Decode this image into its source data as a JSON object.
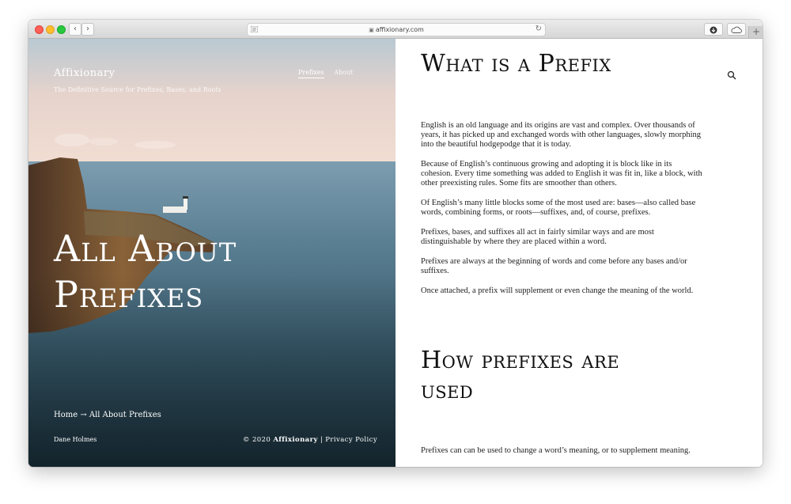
{
  "browser": {
    "url": "affixionary.com",
    "reload_glyph": "↻",
    "back_glyph": "‹",
    "forward_glyph": "›",
    "newtab_glyph": "+",
    "lock_glyph": "🔒"
  },
  "site": {
    "logo": "Affixionary",
    "tagline": "The Definitive Source for Prefixes, Bases, and Roots",
    "nav": [
      "Prefixes",
      "About"
    ]
  },
  "hero": {
    "title": "All About Prefixes",
    "breadcrumb": "Home → All About Prefixes",
    "author": "Dane Holmes",
    "copyright_prefix": "© 2020",
    "copyright_brand": "Affixionary",
    "copyright_sep": "|",
    "privacy_link": "Privacy Policy"
  },
  "article": {
    "heading1": "What is a Prefix",
    "paragraphs": [
      "English is an old language and its origins are vast and complex. Over thousands of years, it has picked up and exchanged words with other languages, slowly morphing into the beautiful hodgepodge that it is today.",
      "Because of English’s continuous growing and adopting it is block like in its cohesion. Every time something was added to English it was fit in, like a block, with other preexisting rules. Some fits are smoother than others.",
      "Of English’s many little blocks some of the most used are: bases—also called base words, combining forms, or roots—suffixes, and, of course, prefixes.",
      "Prefixes, bases, and suffixes all act in fairly similar ways and are most distinguishable by where they are placed within a word.",
      "Prefixes are always at the beginning of words and come before any bases and/or suffixes.",
      "Once attached, a prefix will supplement or even change the meaning of the world."
    ],
    "heading2": "How prefixes are used",
    "paragraph2": "Prefixes can can be used to change a word’s meaning, or to supplement meaning."
  },
  "colors": {
    "sky": "#e9d6cf",
    "sea": "#3e6475",
    "cliff": "#7a5533",
    "text": "#222222"
  }
}
